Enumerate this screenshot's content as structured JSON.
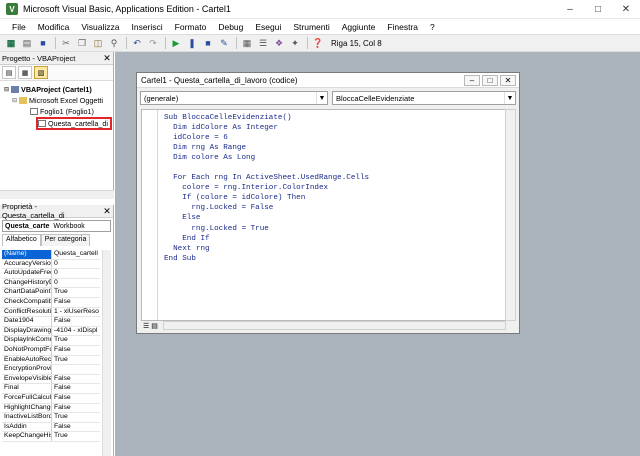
{
  "window": {
    "title": "Microsoft Visual Basic, Applications Edition - Cartel1"
  },
  "menu": [
    "File",
    "Modifica",
    "Visualizza",
    "Inserisci",
    "Formato",
    "Debug",
    "Esegui",
    "Strumenti",
    "Aggiunte",
    "Finestra",
    "?"
  ],
  "toolbar": {
    "position": "Riga 15, Col 8"
  },
  "project_panel": {
    "title": "Progetto - VBAProject",
    "tree": {
      "root": "VBAProject (Cartel1)",
      "folder": "Microsoft Excel Oggetti",
      "sheet": "Foglio1 (Foglio1)",
      "workbook": "Questa_cartella_di"
    }
  },
  "properties_panel": {
    "title": "Proprietà - Questa_cartella_di",
    "object_name": "Questa_carte",
    "object_type": "Workbook",
    "tabs": [
      "Alfabetico",
      "Per categoria"
    ],
    "rows": [
      {
        "key": "(Name)",
        "value": "Questa_cartell"
      },
      {
        "key": "AccuracyVersion",
        "value": "0"
      },
      {
        "key": "AutoUpdateFreq",
        "value": "0"
      },
      {
        "key": "ChangeHistoryD",
        "value": "0"
      },
      {
        "key": "ChartDataPointT",
        "value": "True"
      },
      {
        "key": "CheckCompatibili",
        "value": "False"
      },
      {
        "key": "ConflictResolutio",
        "value": "1 - xlUserReso"
      },
      {
        "key": "Date1904",
        "value": "False"
      },
      {
        "key": "DisplayDrawingO",
        "value": "-4104 - xlDispl"
      },
      {
        "key": "DisplayInkComm",
        "value": "True"
      },
      {
        "key": "DoNotPromptFor",
        "value": "False"
      },
      {
        "key": "EnableAutoReco",
        "value": "True"
      },
      {
        "key": "EncryptionProvi",
        "value": ""
      },
      {
        "key": "EnvelopeVisible",
        "value": "False"
      },
      {
        "key": "Final",
        "value": "False"
      },
      {
        "key": "ForceFullCalcula",
        "value": "False"
      },
      {
        "key": "HighlightChange",
        "value": "False"
      },
      {
        "key": "InactiveListBord",
        "value": "True"
      },
      {
        "key": "IsAddin",
        "value": "False"
      },
      {
        "key": "KeepChangeHis",
        "value": "True"
      }
    ]
  },
  "code_window": {
    "title": "Cartel1 - Questa_cartella_di_lavoro (codice)",
    "object_combo": "(generale)",
    "proc_combo": "BloccaCelleEvidenziate",
    "lines": [
      "Sub BloccaCelleEvidenziate()",
      "  Dim idColore As Integer",
      "  idColore = 6",
      "  Dim rng As Range",
      "  Dim colore As Long",
      "",
      "  For Each rng In ActiveSheet.UsedRange.Cells",
      "    colore = rng.Interior.ColorIndex",
      "    If (colore = idColore) Then",
      "      rng.Locked = False",
      "    Else",
      "      rng.Locked = True",
      "    End If",
      "  Next rng",
      "End Sub"
    ]
  }
}
